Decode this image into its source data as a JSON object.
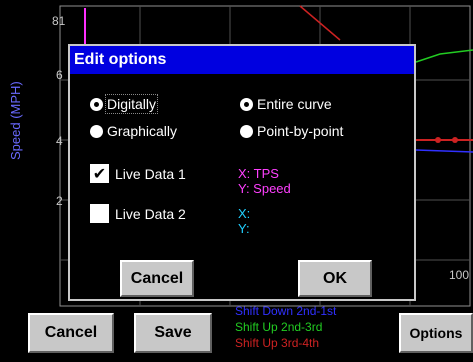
{
  "background": {
    "y_axis_label": "Speed (MPH)",
    "y_ticks": [
      "81",
      "6",
      "4",
      "2"
    ],
    "x_tick": "100",
    "legend": [
      {
        "label": "Shift Down 2nd-1st",
        "color": "#3030ff"
      },
      {
        "label": "Shift Up 2nd-3rd",
        "color": "#22cc22"
      },
      {
        "label": "Shift Up 3rd-4th",
        "color": "#cc2222"
      }
    ],
    "buttons": {
      "cancel": "Cancel",
      "save": "Save",
      "options": "Options"
    }
  },
  "dialog": {
    "title": "Edit options",
    "mode_options": [
      {
        "label": "Digitally",
        "selected": true
      },
      {
        "label": "Graphically",
        "selected": false
      }
    ],
    "scope_options": [
      {
        "label": "Entire curve",
        "selected": true
      },
      {
        "label": "Point-by-point",
        "selected": false
      }
    ],
    "live_data": [
      {
        "label": "Live Data 1",
        "checked": true,
        "x_text": "X: TPS",
        "y_text": "Y: Speed",
        "color": "#ff40ff"
      },
      {
        "label": "Live Data 2",
        "checked": false,
        "x_text": "X:",
        "y_text": "Y:",
        "color": "#20d0ff"
      }
    ],
    "buttons": {
      "cancel": "Cancel",
      "ok": "OK"
    }
  }
}
